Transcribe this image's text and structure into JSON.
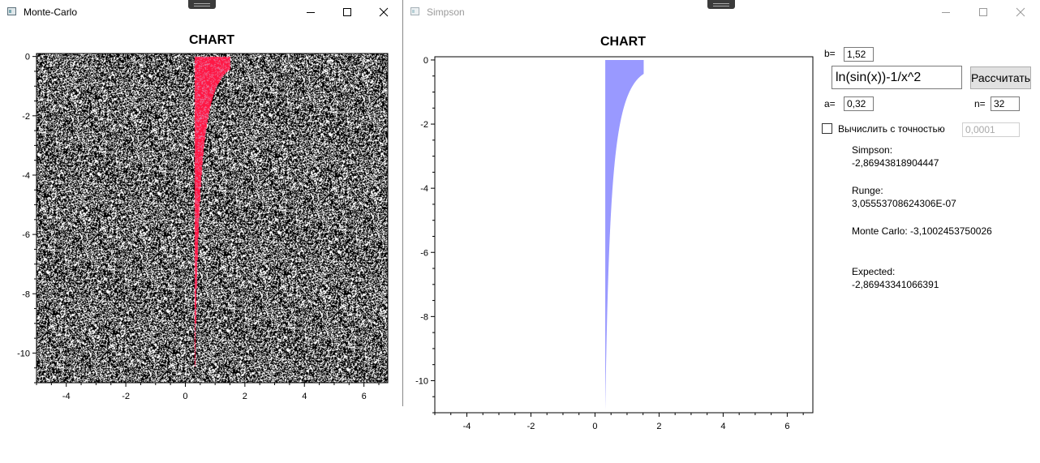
{
  "mc_window": {
    "title": "Monte-Carlo"
  },
  "simpson_window": {
    "title": "Simpson"
  },
  "mc_chart": {
    "title": "CHART"
  },
  "simpson_chart": {
    "title": "CHART"
  },
  "form": {
    "b_label": "b=",
    "b_value": "1,52",
    "function_value": "ln(sin(x))-1/x^2",
    "calc_button": "Рассчитать",
    "a_label": "a=",
    "a_value": "0,32",
    "n_label": "n=",
    "n_value": "32",
    "precision_checkbox_label": "Вычислить с точностью",
    "precision_checked": false,
    "precision_value": "0,0001"
  },
  "results": {
    "simpson_label": "Simpson:",
    "simpson_value": "-2,86943818904447",
    "runge_label": "Runge:",
    "runge_value": "3,05553708624306E-07",
    "monte_carlo": "Monte Carlo: -3,1002453750026",
    "expected_label": "Expected:",
    "expected_value": "-2,86943341066391"
  },
  "colors": {
    "mc_points_outside": "#ffffff",
    "mc_background": "#000000",
    "mc_points_inside": "#ff1744",
    "simpson_fill": "#9999ff"
  },
  "chart_data": [
    {
      "type": "scatter",
      "title": "CHART",
      "function": "ln(sin(x))-1/x^2",
      "x_range": [
        0.32,
        1.52
      ],
      "xlim": [
        -5,
        6.8
      ],
      "ylim": [
        -11,
        0.1
      ],
      "x_ticks": [
        -4,
        -2,
        0,
        2,
        4,
        6
      ],
      "y_ticks": [
        0,
        -2,
        -4,
        -6,
        -8,
        -10
      ],
      "series": [
        {
          "color": "#ff1744"
        },
        {
          "color": "#ffffff"
        }
      ]
    },
    {
      "type": "area",
      "title": "CHART",
      "function": "ln(sin(x))-1/x^2",
      "x_range": [
        0.32,
        1.52
      ],
      "xlim": [
        -5,
        6.8
      ],
      "ylim": [
        -11,
        0.1
      ],
      "x_ticks": [
        -4,
        -2,
        0,
        2,
        4,
        6
      ],
      "y_ticks": [
        0,
        -2,
        -4,
        -6,
        -8,
        -10
      ],
      "fill_color": "#9999ff"
    }
  ]
}
